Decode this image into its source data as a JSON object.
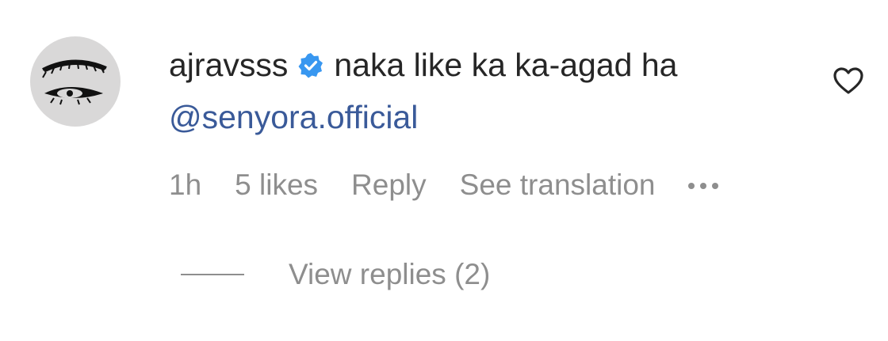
{
  "comment": {
    "username": "ajravsss",
    "text": "naka like ka ka-agad ha",
    "mention": "@senyora.official",
    "time": "1h",
    "likes": "5 likes",
    "reply_label": "Reply",
    "translate_label": "See translation",
    "view_replies": "View replies (2)",
    "verified_color": "#3897f0",
    "mention_color": "#3a5a99",
    "meta_color": "#8e8e8e"
  },
  "icons": {
    "avatar": "eye-avatar",
    "verified": "verified-badge-icon",
    "more": "more-horizontal-icon",
    "like": "heart-icon"
  }
}
